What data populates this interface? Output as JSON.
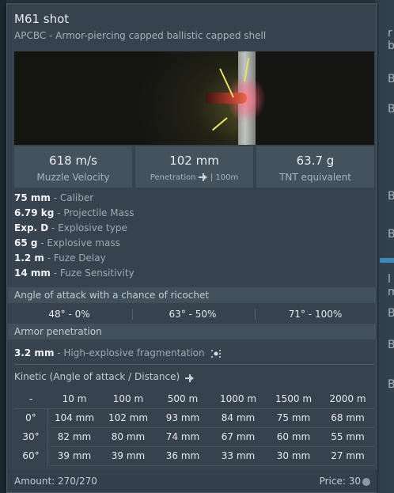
{
  "tooltip": {
    "title": "M61 shot",
    "subtitle": "APCBC - Armor-piercing capped ballistic capped shell"
  },
  "stats": [
    {
      "value": "618 m/s",
      "label": "Muzzle Velocity"
    },
    {
      "value": "102 mm",
      "label": "Penetration",
      "extra": "| 100m",
      "icon": "penetration-icon"
    },
    {
      "value": "63.7 g",
      "label": "TNT equivalent"
    }
  ],
  "properties": [
    {
      "value": "75 mm",
      "label": " - Caliber"
    },
    {
      "value": "6.79 kg",
      "label": " - Projectile Mass"
    },
    {
      "value": "Exp. D",
      "label": " - Explosive type"
    },
    {
      "value": "65 g",
      "label": " - Explosive mass"
    },
    {
      "value": "1.2 m",
      "label": " - Fuze Delay"
    },
    {
      "value": "14 mm",
      "label": " - Fuze Sensitivity"
    }
  ],
  "ricochet": {
    "heading": "Angle of attack with a chance of ricochet",
    "values": [
      "48° - 0%",
      "63° - 50%",
      "71° - 100%"
    ]
  },
  "armor": {
    "heading": "Armor penetration",
    "he_value": "3.2 mm",
    "he_label": " - High-explosive fragmentation",
    "kinetic_heading": "Kinetic (Angle of attack / Distance)"
  },
  "penetration_table": {
    "corner": "-",
    "distances": [
      "10 m",
      "100 m",
      "500 m",
      "1000 m",
      "1500 m",
      "2000 m"
    ],
    "rows": [
      {
        "angle": "0°",
        "values": [
          "104 mm",
          "102 mm",
          "93 mm",
          "84 mm",
          "75 mm",
          "68 mm"
        ]
      },
      {
        "angle": "30°",
        "values": [
          "82 mm",
          "80 mm",
          "74 mm",
          "67 mm",
          "60 mm",
          "55 mm"
        ]
      },
      {
        "angle": "60°",
        "values": [
          "39 mm",
          "39 mm",
          "36 mm",
          "33 mm",
          "30 mm",
          "27 mm"
        ]
      }
    ]
  },
  "footer": {
    "amount": "Amount: 270/270",
    "price": "Price: 30",
    "price_icon": "silver-lion-icon"
  },
  "background": {
    "right_letters": [
      "r b",
      "B",
      "B",
      "B",
      "B",
      "l m",
      "B",
      "B",
      "B"
    ]
  },
  "colors": {
    "panel": "#36424d",
    "section": "#42505c",
    "stat_box": "#44525e",
    "value_text": "#f1f3f5",
    "label_text": "#9fa9b1"
  }
}
